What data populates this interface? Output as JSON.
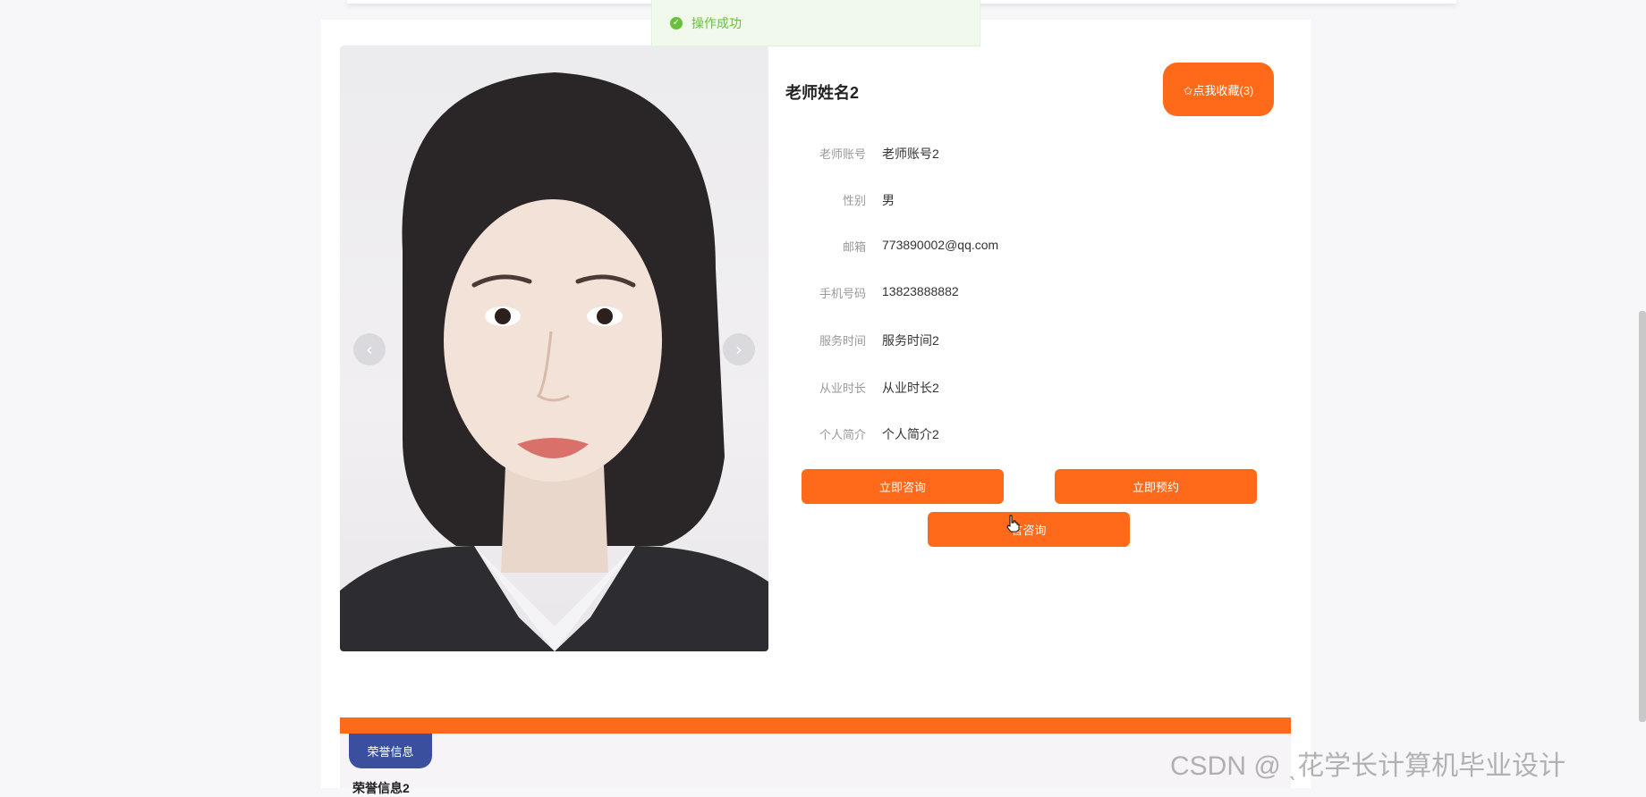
{
  "toast": {
    "message": "操作成功",
    "icon": "check-circle-icon",
    "color": "#67c23a"
  },
  "teacher": {
    "name": "老师姓名2",
    "favorite_label": "✩点我收藏(3)"
  },
  "carousel": {
    "prev_icon": "chevron-left-icon",
    "next_icon": "chevron-right-icon",
    "prev_glyph": "‹",
    "next_glyph": "›"
  },
  "details": [
    {
      "label": "老师账号",
      "value": "老师账号2"
    },
    {
      "label": "性别",
      "value": "男"
    },
    {
      "label": "邮箱",
      "value": "773890002@qq.com"
    },
    {
      "label": "手机号码",
      "value": "13823888882"
    },
    {
      "label": "服务时间",
      "value": "服务时间2"
    },
    {
      "label": "从业时长",
      "value": "从业时长2"
    },
    {
      "label": "个人简介",
      "value": "个人简介2"
    }
  ],
  "actions": {
    "consult_now": "立即咨询",
    "book_now": "立即预约",
    "message_consult": "言咨询"
  },
  "honor": {
    "tab_label": "荣誉信息",
    "partial_text": "荣誉信息2"
  },
  "watermark": "CSDN @ ˎ花学长计算机毕业设计",
  "colors": {
    "accent": "#ff6a1a",
    "tab": "#3a4f9d"
  }
}
